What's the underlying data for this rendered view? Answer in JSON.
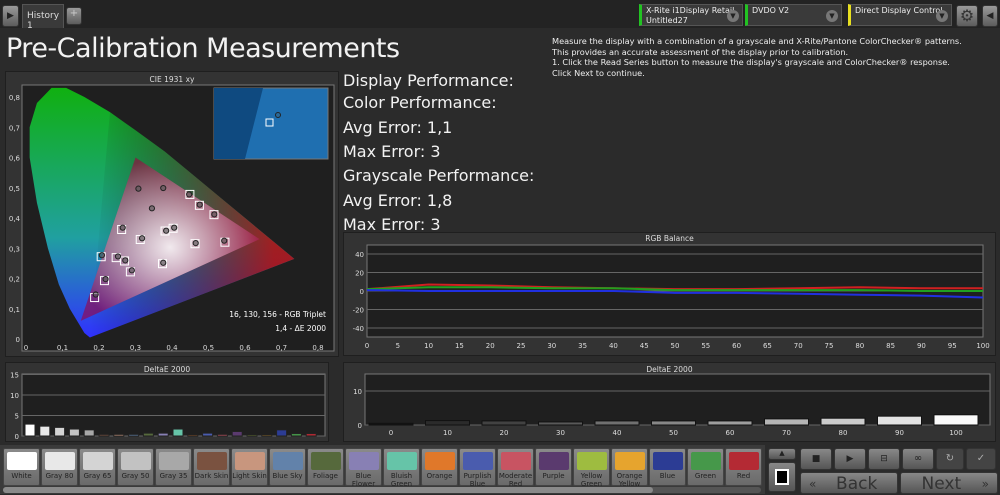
{
  "topbar": {
    "tab": "History 1",
    "add_tab": "+",
    "source1_line1": "X-Rite i1Display Retail",
    "source1_line2": "Untitled27",
    "source2": "DVDO V2",
    "source3": "Direct Display Control",
    "colors": {
      "source1": "#22c322",
      "source2": "#22c322",
      "source3": "#e8e020"
    }
  },
  "page": {
    "title": "Pre-Calibration Measurements",
    "instructions": [
      "Measure the display with a combination of a grayscale and X-Rite/Pantone ColorChecker® patterns.",
      "This provides an accurate assessment of the display prior to calibration.",
      "1. Click the Read Series button to measure the display's grayscale and ColorChecker® response.",
      "Click Next to continue."
    ]
  },
  "stats": {
    "display": "Display Performance:",
    "color": "Color Performance:",
    "color_avg": "Avg Error: 1,1",
    "color_max": "Max Error: 3",
    "gray": "Grayscale Performance:",
    "gray_avg": "Avg Error: 1,8",
    "gray_max": "Max Error: 3"
  },
  "chart_data": [
    {
      "type": "scatter",
      "title": "CIE 1931 xy",
      "xlim": [
        0,
        0.85
      ],
      "ylim": [
        0,
        0.85
      ],
      "xticks": [
        "0",
        "0,1",
        "0,2",
        "0,3",
        "0,4",
        "0,5",
        "0,6",
        "0,7",
        "0,8"
      ],
      "yticks": [
        "0",
        "0,1",
        "0,2",
        "0,3",
        "0,4",
        "0,5",
        "0,6",
        "0,7",
        "0,8"
      ],
      "gamut": [
        [
          0.64,
          0.33
        ],
        [
          0.3,
          0.6
        ],
        [
          0.15,
          0.06
        ]
      ],
      "spectral_locus": [
        [
          0.175,
          0.005
        ],
        [
          0.17,
          0.01
        ],
        [
          0.16,
          0.02
        ],
        [
          0.145,
          0.05
        ],
        [
          0.12,
          0.1
        ],
        [
          0.09,
          0.18
        ],
        [
          0.06,
          0.3
        ],
        [
          0.03,
          0.45
        ],
        [
          0.01,
          0.6
        ],
        [
          0.01,
          0.7
        ],
        [
          0.03,
          0.78
        ],
        [
          0.07,
          0.83
        ],
        [
          0.11,
          0.83
        ],
        [
          0.16,
          0.8
        ],
        [
          0.23,
          0.75
        ],
        [
          0.3,
          0.69
        ],
        [
          0.38,
          0.62
        ],
        [
          0.46,
          0.54
        ],
        [
          0.54,
          0.46
        ],
        [
          0.62,
          0.38
        ],
        [
          0.7,
          0.3
        ],
        [
          0.735,
          0.265
        ]
      ],
      "targets": [
        [
          0.313,
          0.329
        ],
        [
          0.206,
          0.272
        ],
        [
          0.247,
          0.269
        ],
        [
          0.27,
          0.258
        ],
        [
          0.286,
          0.222
        ],
        [
          0.215,
          0.193
        ],
        [
          0.188,
          0.137
        ],
        [
          0.374,
          0.249
        ],
        [
          0.381,
          0.357
        ],
        [
          0.403,
          0.366
        ],
        [
          0.463,
          0.315
        ],
        [
          0.545,
          0.32
        ],
        [
          0.449,
          0.478
        ],
        [
          0.475,
          0.442
        ],
        [
          0.515,
          0.411
        ],
        [
          0.262,
          0.362
        ]
      ],
      "measured": [
        [
          0.318,
          0.333
        ],
        [
          0.208,
          0.277
        ],
        [
          0.252,
          0.273
        ],
        [
          0.272,
          0.26
        ],
        [
          0.29,
          0.227
        ],
        [
          0.218,
          0.198
        ],
        [
          0.191,
          0.147
        ],
        [
          0.376,
          0.252
        ],
        [
          0.384,
          0.358
        ],
        [
          0.406,
          0.368
        ],
        [
          0.465,
          0.317
        ],
        [
          0.543,
          0.325
        ],
        [
          0.447,
          0.478
        ],
        [
          0.476,
          0.444
        ],
        [
          0.516,
          0.412
        ],
        [
          0.265,
          0.368
        ],
        [
          0.308,
          0.497
        ],
        [
          0.376,
          0.499
        ],
        [
          0.345,
          0.432
        ]
      ],
      "readout_rgb": "16, 130, 156 - RGB Triplet",
      "readout_de": "1,4 - ΔE 2000"
    },
    {
      "type": "line",
      "title": "RGB Balance",
      "x": [
        0,
        10,
        20,
        30,
        40,
        50,
        60,
        70,
        80,
        90,
        100
      ],
      "xticks": [
        "0",
        "5",
        "10",
        "15",
        "20",
        "25",
        "30",
        "35",
        "40",
        "45",
        "50",
        "55",
        "60",
        "65",
        "70",
        "75",
        "80",
        "85",
        "90",
        "95",
        "100"
      ],
      "yticks": [
        "40",
        "20",
        "0",
        "-20",
        "-40"
      ],
      "ylim": [
        -50,
        50
      ],
      "series": [
        {
          "name": "Red",
          "color": "#d02020",
          "values": [
            2,
            7,
            6,
            4,
            3,
            2,
            2,
            3,
            4,
            3,
            3
          ]
        },
        {
          "name": "Green",
          "color": "#20a020",
          "values": [
            2,
            4,
            4,
            3,
            3,
            1,
            1,
            1,
            1,
            0,
            0
          ]
        },
        {
          "name": "Blue",
          "color": "#2030e0",
          "values": [
            1,
            0,
            0,
            0,
            0,
            -2,
            -2,
            -3,
            -4,
            -5,
            -7
          ]
        }
      ]
    },
    {
      "type": "bar",
      "title": "DeltaE 2000",
      "ylim": [
        0,
        15
      ],
      "yticks": [
        "15",
        "10",
        "5",
        "0"
      ],
      "values": [
        2.9,
        2.4,
        2.1,
        1.7,
        1.5,
        0.4,
        0.4,
        0.4,
        0.7,
        0.7,
        1.7,
        0.3,
        0.7,
        0.4,
        1.1,
        0.3,
        0.3,
        1.5,
        0.6,
        0.6
      ]
    },
    {
      "type": "bar",
      "title": "DeltaE 2000",
      "ylim": [
        0,
        15
      ],
      "yticks": [
        "10",
        "0"
      ],
      "categories": [
        "0",
        "10",
        "20",
        "30",
        "40",
        "50",
        "60",
        "70",
        "80",
        "90",
        "100"
      ],
      "values": [
        0.5,
        1.3,
        1.2,
        0.9,
        1.2,
        1.2,
        1.2,
        1.8,
        2.0,
        2.6,
        3.0
      ]
    }
  ],
  "swatches": [
    {
      "l1": "White",
      "l2": "",
      "color": "#ffffff"
    },
    {
      "l1": "Gray 80",
      "l2": "",
      "color": "#e8e8e8"
    },
    {
      "l1": "Gray 65",
      "l2": "",
      "color": "#d4d4d4"
    },
    {
      "l1": "Gray 50",
      "l2": "",
      "color": "#c2c2c2"
    },
    {
      "l1": "Gray 35",
      "l2": "",
      "color": "#a8a8a8"
    },
    {
      "l1": "Dark Skin",
      "l2": "",
      "color": "#7a5240"
    },
    {
      "l1": "Light Skin",
      "l2": "",
      "color": "#c8967e"
    },
    {
      "l1": "Blue Sky",
      "l2": "",
      "color": "#6282aa"
    },
    {
      "l1": "Foliage",
      "l2": "",
      "color": "#56693c"
    },
    {
      "l1": "Blue",
      "l2": "Flower",
      "color": "#8880b4"
    },
    {
      "l1": "Bluish",
      "l2": "Green",
      "color": "#66c4a8"
    },
    {
      "l1": "Orange",
      "l2": "",
      "color": "#e0782a"
    },
    {
      "l1": "Purplish",
      "l2": "Blue",
      "color": "#4a5cae"
    },
    {
      "l1": "Moderate",
      "l2": "Red",
      "color": "#c85462"
    },
    {
      "l1": "Purple",
      "l2": "",
      "color": "#5a3a6e"
    },
    {
      "l1": "Yellow",
      "l2": "Green",
      "color": "#9ebc40"
    },
    {
      "l1": "Orange",
      "l2": "Yellow",
      "color": "#e6a42e"
    },
    {
      "l1": "Blue",
      "l2": "",
      "color": "#2c3c94"
    },
    {
      "l1": "Green",
      "l2": "",
      "color": "#46984a"
    },
    {
      "l1": "Red",
      "l2": "",
      "color": "#b42a34"
    }
  ],
  "nav": {
    "back": "Back",
    "next": "Next",
    "back_arrow": "«",
    "next_arrow": "»"
  }
}
